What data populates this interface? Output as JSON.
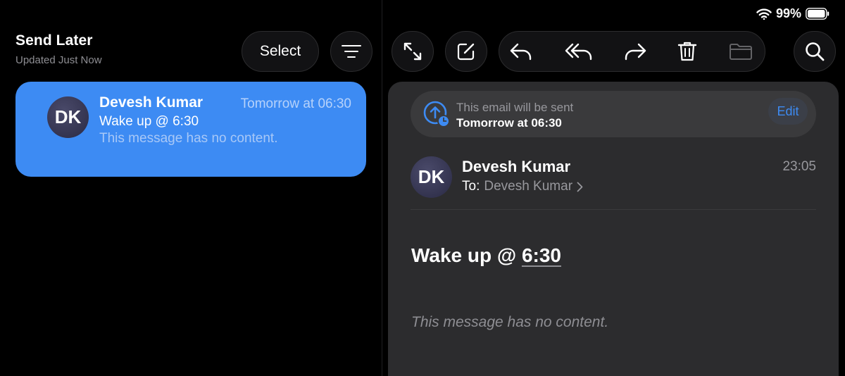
{
  "status_bar": {
    "battery": "99%",
    "icons": [
      "wifi-icon",
      "battery-icon"
    ]
  },
  "mailbox": {
    "title": "Send Later",
    "subtitle": "Updated Just Now",
    "select_label": "Select",
    "icons": [
      "filter-icon"
    ]
  },
  "message_list": [
    {
      "initials": "DK",
      "sender": "Devesh Kumar",
      "time": "Tomorrow at 06:30",
      "subject": "Wake up @ 6:30",
      "preview": "This message has no content."
    }
  ],
  "toolbar": {
    "icons": [
      "expand-icon",
      "compose-icon",
      "reply-icon",
      "reply-all-icon",
      "forward-icon",
      "trash-icon",
      "folder-icon",
      "search-icon"
    ]
  },
  "message": {
    "schedule_line1": "This email will be sent",
    "schedule_line2": "Tomorrow at 06:30",
    "edit_label": "Edit",
    "initials": "DK",
    "sender": "Devesh Kumar",
    "time": "23:05",
    "to_label": "To:",
    "to_name": "Devesh Kumar",
    "subject_prefix": "Wake up @ ",
    "subject_time": "6:30",
    "body": "This message has no content."
  },
  "colors": {
    "accent": "#3d8bf3",
    "background": "#000000",
    "pane": "#2c2c2e",
    "secondary_text": "#8e8e93"
  }
}
